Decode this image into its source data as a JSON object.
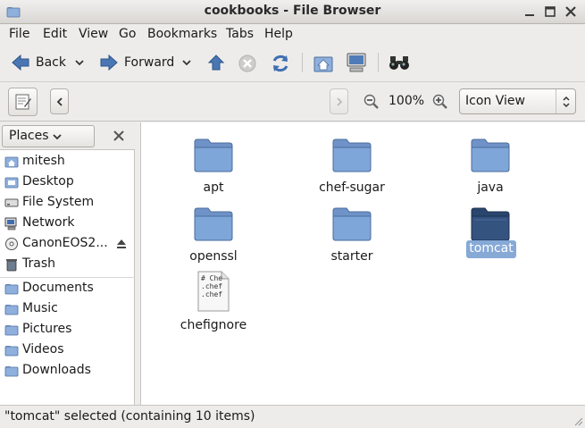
{
  "window": {
    "title": "cookbooks - File Browser"
  },
  "menubar": {
    "items": [
      "File",
      "Edit",
      "View",
      "Go",
      "Bookmarks",
      "Tabs",
      "Help"
    ]
  },
  "toolbar": {
    "back_label": "Back",
    "forward_label": "Forward"
  },
  "locationbar": {
    "zoom_level": "100%",
    "view_mode": "Icon View"
  },
  "sidebar": {
    "header": "Places",
    "items": [
      {
        "label": "mitesh",
        "icon": "home-folder-icon"
      },
      {
        "label": "Desktop",
        "icon": "desktop-folder-icon"
      },
      {
        "label": "File System",
        "icon": "filesystem-icon"
      },
      {
        "label": "Network",
        "icon": "network-icon"
      },
      {
        "label": "CanonEOS2...",
        "icon": "camera-disc-icon"
      },
      {
        "label": "Trash",
        "icon": "trash-icon"
      },
      {
        "label": "Documents",
        "icon": "folder-icon"
      },
      {
        "label": "Music",
        "icon": "folder-icon"
      },
      {
        "label": "Pictures",
        "icon": "folder-icon"
      },
      {
        "label": "Videos",
        "icon": "folder-icon"
      },
      {
        "label": "Downloads",
        "icon": "folder-icon"
      }
    ]
  },
  "files": [
    {
      "name": "apt",
      "type": "folder"
    },
    {
      "name": "chef-sugar",
      "type": "folder"
    },
    {
      "name": "java",
      "type": "folder"
    },
    {
      "name": "openssl",
      "type": "folder"
    },
    {
      "name": "starter",
      "type": "folder"
    },
    {
      "name": "tomcat",
      "type": "folder",
      "selected": true
    },
    {
      "name": "chefignore",
      "type": "text-file",
      "preview": [
        "# Che",
        ".chef",
        ".chef"
      ]
    }
  ],
  "statusbar": {
    "text": "\"tomcat\" selected (containing 10 items)"
  },
  "colors": {
    "folder": "#7fa6d8",
    "selected_folder": "#2f4f7a",
    "selection": "#86a9d6"
  }
}
